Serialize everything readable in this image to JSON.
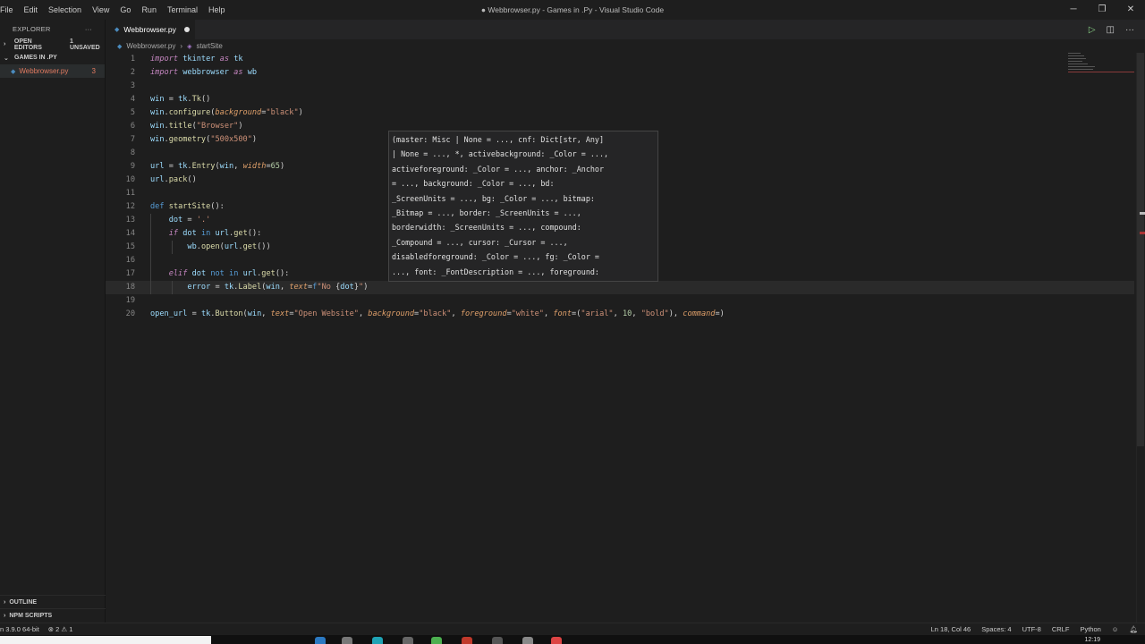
{
  "menu": [
    "File",
    "Edit",
    "Selection",
    "View",
    "Go",
    "Run",
    "Terminal",
    "Help"
  ],
  "window_title": "● Webbrowser.py - Games in .Py - Visual Studio Code",
  "sidebar": {
    "title": "EXPLORER",
    "more": "···",
    "open_editors": "OPEN EDITORS",
    "unsaved": "1 UNSAVED",
    "folder": "GAMES IN .PY",
    "file": {
      "name": "Webbrowser.py",
      "problems": "3",
      "icon": "python-file-icon"
    },
    "outline": "OUTLINE",
    "npm_scripts": "NPM SCRIPTS"
  },
  "tab": {
    "label": "Webbrowser.py",
    "modified": true
  },
  "breadcrumb": {
    "file": "Webbrowser.py",
    "symbol": "startSite"
  },
  "code": {
    "lines": [
      {
        "n": "1",
        "tokens": [
          [
            "kw",
            "import"
          ],
          [
            "txt",
            " "
          ],
          [
            "var",
            "tkinter"
          ],
          [
            "txt",
            " "
          ],
          [
            "kw",
            "as"
          ],
          [
            "txt",
            " "
          ],
          [
            "var",
            "tk"
          ]
        ]
      },
      {
        "n": "2",
        "tokens": [
          [
            "kw",
            "import"
          ],
          [
            "txt",
            " "
          ],
          [
            "var",
            "webbrowser"
          ],
          [
            "txt",
            " "
          ],
          [
            "kw",
            "as"
          ],
          [
            "txt",
            " "
          ],
          [
            "var",
            "wb"
          ]
        ]
      },
      {
        "n": "3",
        "tokens": []
      },
      {
        "n": "4",
        "tokens": [
          [
            "var",
            "win"
          ],
          [
            "txt",
            " = "
          ],
          [
            "var",
            "tk"
          ],
          [
            "txt",
            "."
          ],
          [
            "fn",
            "Tk"
          ],
          [
            "txt",
            "()"
          ]
        ]
      },
      {
        "n": "5",
        "tokens": [
          [
            "var",
            "win"
          ],
          [
            "txt",
            "."
          ],
          [
            "fn",
            "configure"
          ],
          [
            "txt",
            "("
          ],
          [
            "prm",
            "background"
          ],
          [
            "txt",
            "="
          ],
          [
            "str",
            "\"black\""
          ],
          [
            "txt",
            ")"
          ]
        ]
      },
      {
        "n": "6",
        "tokens": [
          [
            "var",
            "win"
          ],
          [
            "txt",
            "."
          ],
          [
            "fn",
            "title"
          ],
          [
            "txt",
            "("
          ],
          [
            "str",
            "\"Browser\""
          ],
          [
            "txt",
            ")"
          ]
        ]
      },
      {
        "n": "7",
        "tokens": [
          [
            "var",
            "win"
          ],
          [
            "txt",
            "."
          ],
          [
            "fn",
            "geometry"
          ],
          [
            "txt",
            "("
          ],
          [
            "str",
            "\"500x500\""
          ],
          [
            "txt",
            ")"
          ]
        ]
      },
      {
        "n": "8",
        "tokens": []
      },
      {
        "n": "9",
        "tokens": [
          [
            "var",
            "url"
          ],
          [
            "txt",
            " = "
          ],
          [
            "var",
            "tk"
          ],
          [
            "txt",
            "."
          ],
          [
            "fn",
            "Entry"
          ],
          [
            "txt",
            "("
          ],
          [
            "var",
            "win"
          ],
          [
            "txt",
            ", "
          ],
          [
            "prm",
            "width"
          ],
          [
            "txt",
            "="
          ],
          [
            "num",
            "65"
          ],
          [
            "txt",
            ")"
          ]
        ]
      },
      {
        "n": "10",
        "tokens": [
          [
            "var",
            "url"
          ],
          [
            "txt",
            "."
          ],
          [
            "fn",
            "pack"
          ],
          [
            "txt",
            "()"
          ]
        ]
      },
      {
        "n": "11",
        "tokens": []
      },
      {
        "n": "12",
        "tokens": [
          [
            "kw2",
            "def"
          ],
          [
            "txt",
            " "
          ],
          [
            "fn",
            "startSite"
          ],
          [
            "txt",
            "():"
          ]
        ]
      },
      {
        "n": "13",
        "tokens": [
          [
            "txt",
            "    "
          ],
          [
            "var",
            "dot"
          ],
          [
            "txt",
            " = "
          ],
          [
            "str",
            "'.'"
          ]
        ]
      },
      {
        "n": "14",
        "tokens": [
          [
            "txt",
            "    "
          ],
          [
            "kw",
            "if"
          ],
          [
            "txt",
            " "
          ],
          [
            "var",
            "dot"
          ],
          [
            "txt",
            " "
          ],
          [
            "kw2",
            "in"
          ],
          [
            "txt",
            " "
          ],
          [
            "var",
            "url"
          ],
          [
            "txt",
            "."
          ],
          [
            "fn",
            "get"
          ],
          [
            "txt",
            "():"
          ]
        ]
      },
      {
        "n": "15",
        "tokens": [
          [
            "txt",
            "        "
          ],
          [
            "var",
            "wb"
          ],
          [
            "txt",
            "."
          ],
          [
            "fn",
            "open"
          ],
          [
            "txt",
            "("
          ],
          [
            "var",
            "url"
          ],
          [
            "txt",
            "."
          ],
          [
            "fn",
            "get"
          ],
          [
            "txt",
            "())"
          ]
        ]
      },
      {
        "n": "16",
        "tokens": []
      },
      {
        "n": "17",
        "tokens": [
          [
            "txt",
            "    "
          ],
          [
            "kw",
            "elif"
          ],
          [
            "txt",
            " "
          ],
          [
            "var",
            "dot"
          ],
          [
            "txt",
            " "
          ],
          [
            "kw2",
            "not"
          ],
          [
            "txt",
            " "
          ],
          [
            "kw2",
            "in"
          ],
          [
            "txt",
            " "
          ],
          [
            "var",
            "url"
          ],
          [
            "txt",
            "."
          ],
          [
            "fn",
            "get"
          ],
          [
            "txt",
            "():"
          ]
        ]
      },
      {
        "n": "18",
        "tokens": [
          [
            "txt",
            "        "
          ],
          [
            "var",
            "error"
          ],
          [
            "txt",
            " = "
          ],
          [
            "var",
            "tk"
          ],
          [
            "txt",
            "."
          ],
          [
            "fn",
            "Label"
          ],
          [
            "txt",
            "("
          ],
          [
            "var",
            "win"
          ],
          [
            "txt",
            ", "
          ],
          [
            "prm",
            "text"
          ],
          [
            "txt",
            "="
          ],
          [
            "kw2",
            "f"
          ],
          [
            "str",
            "\"No "
          ],
          [
            "txt",
            "{"
          ],
          [
            "var",
            "dot"
          ],
          [
            "txt",
            "}"
          ],
          [
            "str",
            "\""
          ],
          [
            "txt",
            ")"
          ]
        ]
      },
      {
        "n": "19",
        "tokens": []
      },
      {
        "n": "20",
        "tokens": [
          [
            "var",
            "open_url"
          ],
          [
            "txt",
            " = "
          ],
          [
            "var",
            "tk"
          ],
          [
            "txt",
            "."
          ],
          [
            "fn",
            "Button"
          ],
          [
            "txt",
            "("
          ],
          [
            "var",
            "win"
          ],
          [
            "txt",
            ", "
          ],
          [
            "prm",
            "text"
          ],
          [
            "txt",
            "="
          ],
          [
            "str",
            "\"Open Website\""
          ],
          [
            "txt",
            ", "
          ],
          [
            "prm",
            "background"
          ],
          [
            "txt",
            "="
          ],
          [
            "str",
            "\"black\""
          ],
          [
            "txt",
            ", "
          ],
          [
            "prm",
            "foreground"
          ],
          [
            "txt",
            "="
          ],
          [
            "str",
            "\"white\""
          ],
          [
            "txt",
            ", "
          ],
          [
            "prm",
            "font"
          ],
          [
            "txt",
            "=("
          ],
          [
            "str",
            "\"arial\""
          ],
          [
            "txt",
            ", "
          ],
          [
            "num",
            "10"
          ],
          [
            "txt",
            ", "
          ],
          [
            "str",
            "\"bold\""
          ],
          [
            "txt",
            "), "
          ],
          [
            "prm",
            "command"
          ],
          [
            "txt",
            "=)"
          ]
        ]
      }
    ]
  },
  "hover": {
    "lines": [
      "(master: Misc | None = ..., cnf: Dict[str, Any]",
      "| None = ..., *, activebackground: _Color = ...,",
      "activeforeground: _Color = ..., anchor: _Anchor",
      "= ..., background: _Color = ..., bd:",
      "_ScreenUnits = ..., bg: _Color = ..., bitmap:",
      "_Bitmap = ..., border: _ScreenUnits = ...,",
      "borderwidth: _ScreenUnits = ..., compound:",
      "_Compound = ..., cursor: _Cursor = ...,",
      "disabledforeground: _Color = ..., fg: _Color =",
      "..., font: _FontDescription = ..., foreground:"
    ]
  },
  "status": {
    "interpreter": "n 3.9.0 64-bit",
    "problems": "⊗ 2 ⚠ 1",
    "position": "Ln 18, Col 46",
    "spaces": "Spaces: 4",
    "encoding": "UTF-8",
    "eol": "CRLF",
    "language": "Python"
  },
  "taskbar": {
    "clock": "12:19"
  },
  "colors": {
    "background": "#1e1e1e",
    "modified_file": "#e27b61",
    "python_icon": "#4b8bbe"
  }
}
